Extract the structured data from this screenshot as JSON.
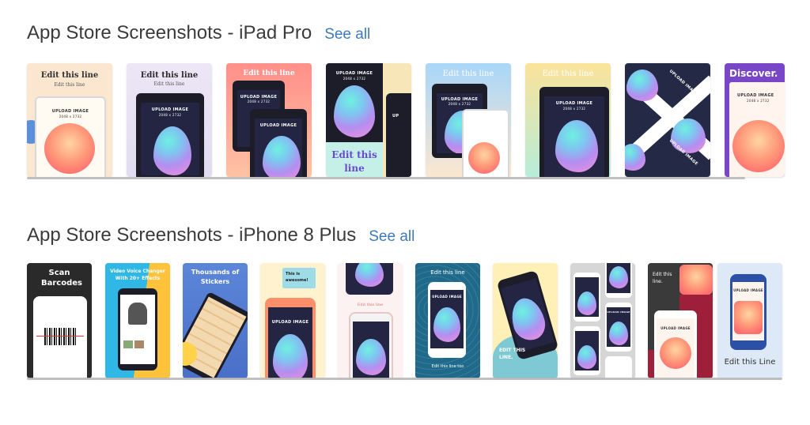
{
  "sections": [
    {
      "title": "App Store Screenshots - iPad Pro",
      "see_all": "See all",
      "cards": [
        {
          "heading": "Edit this line",
          "sub": "Edit this line",
          "upload": "UPLOAD IMAGE",
          "dims": "2048 x 2732"
        },
        {
          "heading": "Edit this line",
          "sub": "Edit this line",
          "upload": "UPLOAD IMAGE",
          "dims": "2048 x 2732"
        },
        {
          "heading": "Edit this line",
          "upload": "UPLOAD IMAGE",
          "dims": "2048 x 2732"
        },
        {
          "heading": "Edit this line",
          "upload": "UPLOAD IMAGE",
          "dims": "2048 x 2732"
        },
        {
          "heading": "Edit this line",
          "upload": "UPLOAD IMAGE",
          "dims": "2048 x 2732"
        },
        {
          "heading": "Edit this line",
          "upload": "UPLOAD IMAGE",
          "dims": "2048 x 2732"
        },
        {
          "upload": "UPLOAD IMAGE"
        },
        {
          "heading": "Discover.",
          "upload": "UPLOAD IMAGE",
          "dims": "2048 x 2732"
        }
      ]
    },
    {
      "title": "App Store Screenshots - iPhone 8 Plus",
      "see_all": "See all",
      "cards": [
        {
          "heading": "Scan Barcodes"
        },
        {
          "heading": "Video Voice Changer With 20+ Effects"
        },
        {
          "heading": "Thousands of Stickers"
        },
        {
          "heading": "This is awesome!",
          "upload": "UPLOAD IMAGE"
        },
        {
          "heading": "Edit this line"
        },
        {
          "heading": "Edit this line",
          "upload": "UPLOAD IMAGE",
          "sub": "Edit this line too"
        },
        {
          "heading": "EDIT THIS LINE."
        },
        {
          "upload": "UPLOAD IMAGE"
        },
        {
          "heading": "Edit this line.",
          "upload": "UPLOAD IMAGE"
        },
        {
          "heading": "Edit this Line",
          "upload": "UPLOAD IMAGE"
        }
      ]
    }
  ],
  "colors": {
    "link": "#3d7ab8",
    "title": "#3b3b3b",
    "scrollbar": "#b5b5b5"
  }
}
